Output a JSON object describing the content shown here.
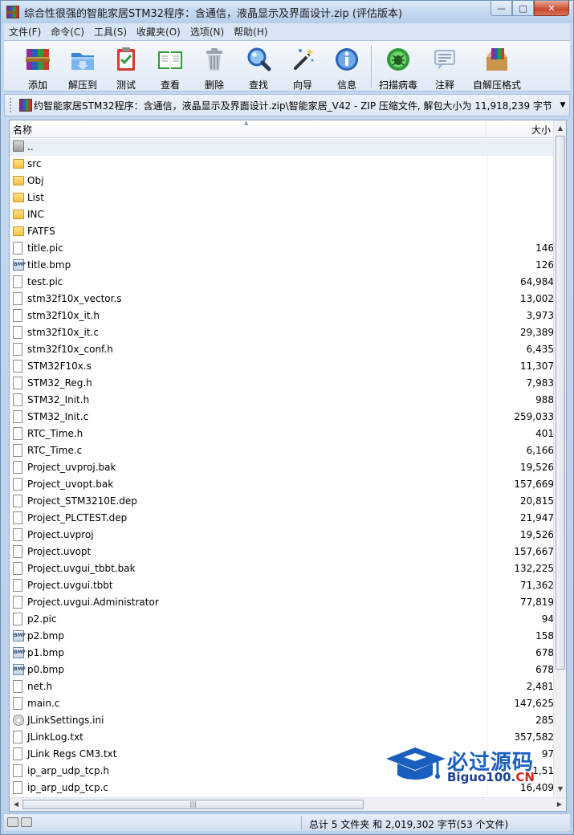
{
  "window": {
    "title": "综合性很强的智能家居STM32程序：含通信，液晶显示及界面设计.zip (评估版本)",
    "min_label": "—",
    "max_label": "□",
    "close_label": "✕"
  },
  "menu": [
    "文件(F)",
    "命令(C)",
    "工具(S)",
    "收藏夹(O)",
    "选项(N)",
    "帮助(H)"
  ],
  "toolbar": [
    {
      "label": "添加",
      "icon": "books-add-icon"
    },
    {
      "label": "解压到",
      "icon": "extract-folder-icon"
    },
    {
      "label": "测试",
      "icon": "test-clipboard-icon"
    },
    {
      "label": "查看",
      "icon": "view-book-icon"
    },
    {
      "label": "删除",
      "icon": "trash-icon"
    },
    {
      "label": "查找",
      "icon": "magnifier-icon"
    },
    {
      "label": "向导",
      "icon": "wizard-wand-icon"
    },
    {
      "label": "信息",
      "icon": "info-icon"
    },
    {
      "label": "扫描病毒",
      "icon": "virus-scan-icon"
    },
    {
      "label": "注释",
      "icon": "comment-icon"
    },
    {
      "label": "自解压格式",
      "icon": "sfx-box-icon"
    }
  ],
  "address": {
    "path": "约智能家居STM32程序：含通信，液晶显示及界面设计.zip\\智能家居_V42 - ZIP 压缩文件, 解包大小为 11,918,239 字节",
    "drop": "▼"
  },
  "columns": {
    "name": "名称",
    "size": "大小",
    "sort_arrow": "▲"
  },
  "files": [
    {
      "name": "..",
      "size": "",
      "type": "up"
    },
    {
      "name": "src",
      "size": "",
      "type": "folder"
    },
    {
      "name": "Obj",
      "size": "",
      "type": "folder"
    },
    {
      "name": "List",
      "size": "",
      "type": "folder"
    },
    {
      "name": "INC",
      "size": "",
      "type": "folder"
    },
    {
      "name": "FATFS",
      "size": "",
      "type": "folder"
    },
    {
      "name": "title.pic",
      "size": "146",
      "type": "doc"
    },
    {
      "name": "title.bmp",
      "size": "126",
      "type": "bmp"
    },
    {
      "name": "test.pic",
      "size": "64,984",
      "type": "doc"
    },
    {
      "name": "stm32f10x_vector.s",
      "size": "13,002",
      "type": "doc"
    },
    {
      "name": "stm32f10x_it.h",
      "size": "3,973",
      "type": "doc"
    },
    {
      "name": "stm32f10x_it.c",
      "size": "29,389",
      "type": "doc"
    },
    {
      "name": "stm32f10x_conf.h",
      "size": "6,435",
      "type": "doc"
    },
    {
      "name": "STM32F10x.s",
      "size": "11,307",
      "type": "doc"
    },
    {
      "name": "STM32_Reg.h",
      "size": "7,983",
      "type": "doc"
    },
    {
      "name": "STM32_Init.h",
      "size": "988",
      "type": "doc"
    },
    {
      "name": "STM32_Init.c",
      "size": "259,033",
      "type": "doc"
    },
    {
      "name": "RTC_Time.h",
      "size": "401",
      "type": "doc"
    },
    {
      "name": "RTC_Time.c",
      "size": "6,166",
      "type": "doc"
    },
    {
      "name": "Project_uvproj.bak",
      "size": "19,526",
      "type": "doc"
    },
    {
      "name": "Project_uvopt.bak",
      "size": "157,669",
      "type": "doc"
    },
    {
      "name": "Project_STM3210E.dep",
      "size": "20,815",
      "type": "doc"
    },
    {
      "name": "Project_PLCTEST.dep",
      "size": "21,947",
      "type": "doc"
    },
    {
      "name": "Project.uvproj",
      "size": "19,526",
      "type": "doc"
    },
    {
      "name": "Project.uvopt",
      "size": "157,667",
      "type": "doc"
    },
    {
      "name": "Project.uvgui_tbbt.bak",
      "size": "132,225",
      "type": "doc"
    },
    {
      "name": "Project.uvgui.tbbt",
      "size": "71,362",
      "type": "doc"
    },
    {
      "name": "Project.uvgui.Administrator",
      "size": "77,819",
      "type": "doc"
    },
    {
      "name": "p2.pic",
      "size": "94",
      "type": "doc"
    },
    {
      "name": "p2.bmp",
      "size": "158",
      "type": "bmp"
    },
    {
      "name": "p1.bmp",
      "size": "678",
      "type": "bmp"
    },
    {
      "name": "p0.bmp",
      "size": "678",
      "type": "bmp"
    },
    {
      "name": "net.h",
      "size": "2,481",
      "type": "doc"
    },
    {
      "name": "main.c",
      "size": "147,625",
      "type": "doc"
    },
    {
      "name": "JLinkSettings.ini",
      "size": "285",
      "type": "ini"
    },
    {
      "name": "JLinkLog.txt",
      "size": "357,582",
      "type": "doc"
    },
    {
      "name": "JLink Regs CM3.txt",
      "size": "97",
      "type": "doc"
    },
    {
      "name": "ip_arp_udp_tcp.h",
      "size": "1,51",
      "type": "doc"
    },
    {
      "name": "ip_arp_udp_tcp.c",
      "size": "16,409",
      "type": "doc"
    }
  ],
  "scroll": {
    "hgrip": "|||"
  },
  "status": {
    "text": "总计 5 文件夹 和 2,019,302 字节(53 个文件)"
  },
  "watermark": {
    "cn": "必过源码",
    "en_main": "Biguo100.",
    "en_red": "CN"
  },
  "colors": {
    "accent": "#1a5fbf",
    "watermark_red": "#d8231c"
  }
}
